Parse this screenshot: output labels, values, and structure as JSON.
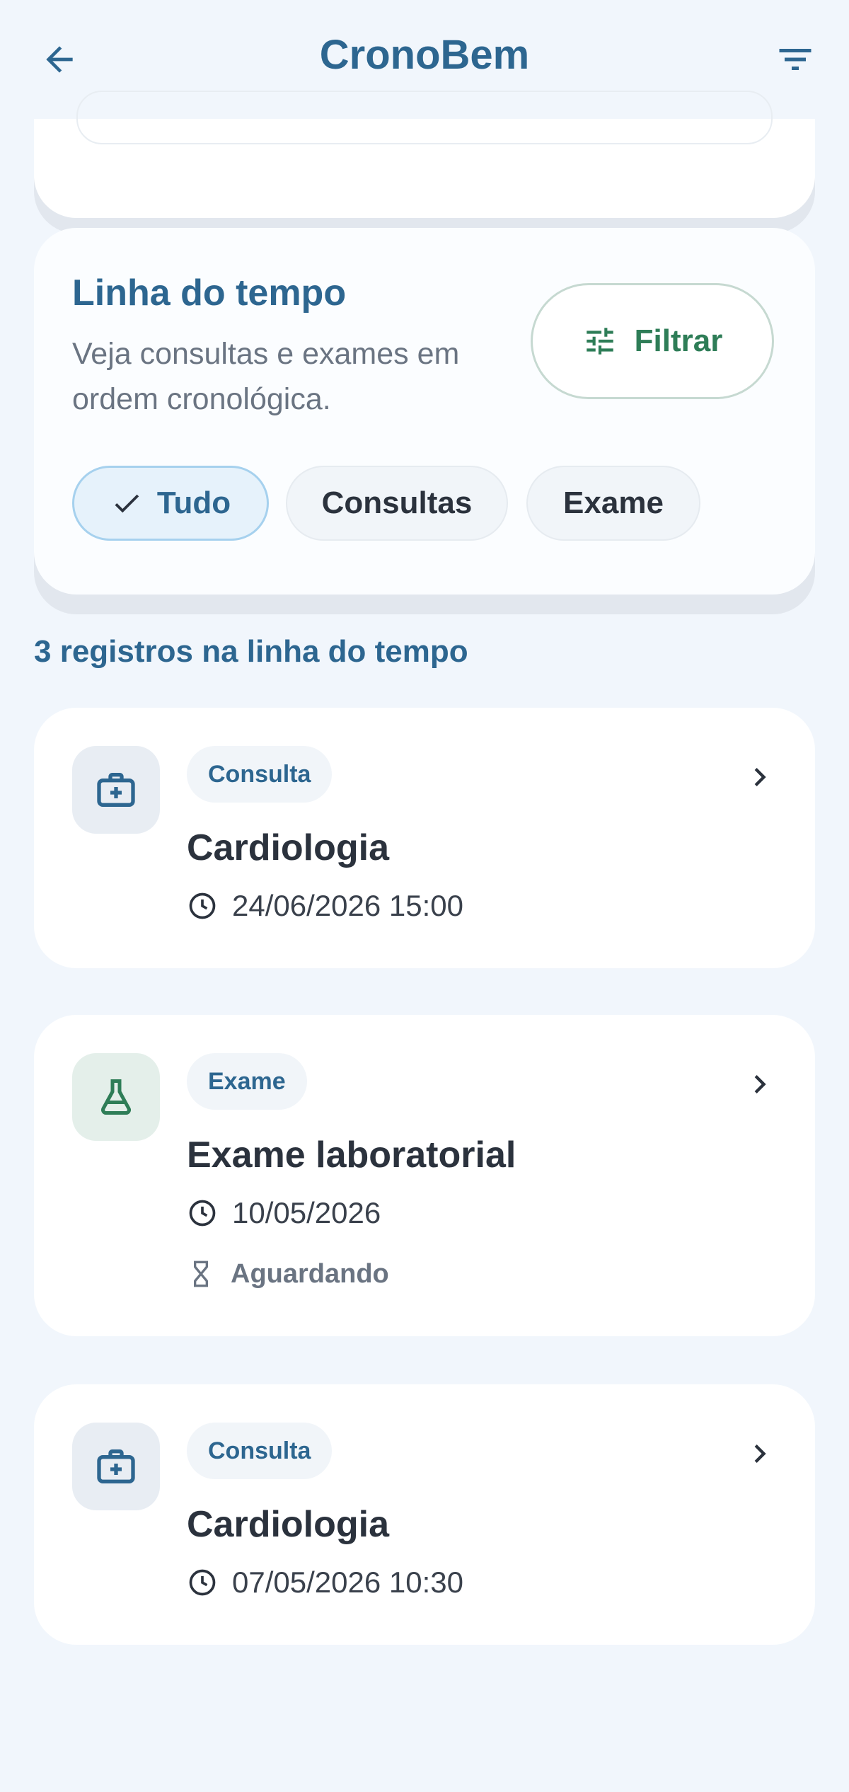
{
  "app": {
    "title": "CronoBem"
  },
  "timeline": {
    "title": "Linha do tempo",
    "subtitle": "Veja consultas e exames em ordem cronológica.",
    "filter_button": "Filtrar",
    "chips": [
      {
        "label": "Tudo",
        "selected": true
      },
      {
        "label": "Consultas",
        "selected": false
      },
      {
        "label": "Exame",
        "selected": false
      }
    ]
  },
  "records_count": "3 registros na linha do tempo",
  "records": [
    {
      "badge": "Consulta",
      "title": "Cardiologia",
      "datetime": "24/06/2026 15:00",
      "icon": "medical-kit-icon"
    },
    {
      "badge": "Exame",
      "title": "Exame laboratorial",
      "datetime": "10/05/2026",
      "status": "Aguardando",
      "icon": "flask-icon"
    },
    {
      "badge": "Consulta",
      "title": "Cardiologia",
      "datetime": "07/05/2026 10:30",
      "icon": "medical-kit-icon"
    }
  ],
  "colors": {
    "primary": "#2d6690",
    "accent_green": "#2e7d57",
    "background": "#f1f6fc"
  }
}
